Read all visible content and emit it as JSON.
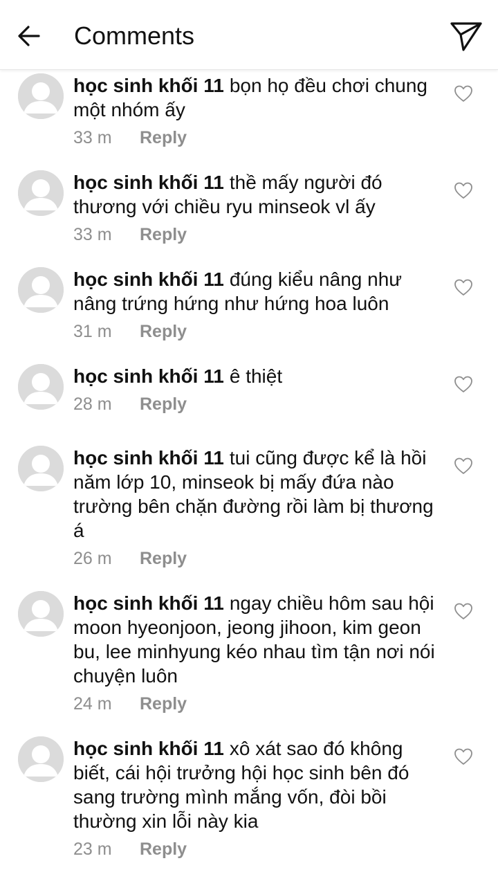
{
  "header": {
    "title": "Comments"
  },
  "comments": [
    {
      "username": "học sinh khối 11",
      "text": "bọn họ đều chơi chung một nhóm ấy",
      "time": "33 m",
      "reply_label": "Reply"
    },
    {
      "username": "học sinh khối 11",
      "text": "thề mấy người đó thương với chiều ryu minseok vl ấy",
      "time": "33 m",
      "reply_label": "Reply"
    },
    {
      "username": "học sinh khối 11",
      "text": "đúng kiểu nâng như nâng trứng hứng như hứng hoa luôn",
      "time": "31 m",
      "reply_label": "Reply"
    },
    {
      "username": "học sinh khối 11",
      "text": "ê thiệt",
      "time": "28 m",
      "reply_label": "Reply"
    },
    {
      "username": "học sinh khối 11",
      "text": "tui cũng được kể là hồi năm lớp 10, minseok bị mấy đứa nào trường bên chặn đường rồi làm bị thương á",
      "time": "26 m",
      "reply_label": "Reply"
    },
    {
      "username": "học sinh khối 11",
      "text": "ngay chiều hôm sau hội moon hyeonjoon, jeong jihoon, kim geon bu, lee minhyung kéo nhau tìm tận nơi nói chuyện luôn",
      "time": "24 m",
      "reply_label": "Reply"
    },
    {
      "username": "học sinh khối 11",
      "text": "xô xát sao đó không biết, cái hội trưởng hội học sinh bên đó sang trường mình mắng vốn, đòi bồi thường xin lỗi này kia",
      "time": "23 m",
      "reply_label": "Reply"
    }
  ]
}
